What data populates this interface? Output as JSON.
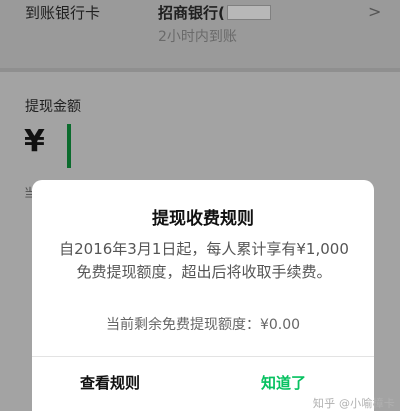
{
  "header": {
    "label": "到账银行卡",
    "bank_name": "招商银行(",
    "arrival_time": "2小时内到账",
    "chevron": ">"
  },
  "amount": {
    "label": "提现金额",
    "currency_symbol": "¥",
    "hint_fragment": "当"
  },
  "dialog": {
    "title": "提现收费规则",
    "body": "自2016年3月1日起，每人累计享有¥1,000免费提现额度，超出后将收取手续费。",
    "remaining": "当前剩余免费提现额度：¥0.00",
    "button_rules": "查看规则",
    "button_ok": "知道了"
  },
  "watermark": {
    "text": "知乎 @小喻樟卡"
  },
  "colors": {
    "accent": "#07c160",
    "cursor": "#0b6b2d"
  }
}
